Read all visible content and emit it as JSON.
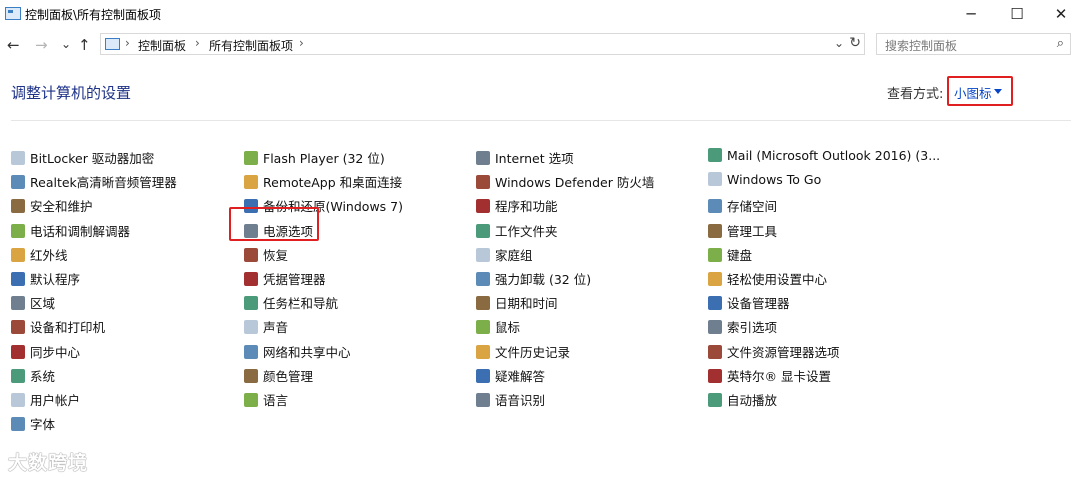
{
  "window": {
    "title": "控制面板\\所有控制面板项",
    "minimize": "─",
    "maximize": "☐",
    "close": "✕"
  },
  "nav": {
    "back": "←",
    "forward": "→",
    "recent": "⌄",
    "up": "↑"
  },
  "address": {
    "crumbs": [
      "控制面板",
      "所有控制面板项"
    ],
    "sep": "›",
    "dropdown": "⌄",
    "refresh": "↻"
  },
  "search": {
    "placeholder": "搜索控制面板",
    "icon": "⌕"
  },
  "heading": "调整计算机的设置",
  "view": {
    "label": "查看方式:",
    "value": "小图标"
  },
  "columns": [
    [
      {
        "label": "BitLocker 驱动器加密",
        "icon": "bitlocker-icon"
      },
      {
        "label": "Realtek高清晰音频管理器",
        "icon": "realtek-audio-icon"
      },
      {
        "label": "安全和维护",
        "icon": "flag-icon"
      },
      {
        "label": "电话和调制解调器",
        "icon": "phone-modem-icon"
      },
      {
        "label": "红外线",
        "icon": "infrared-icon"
      },
      {
        "label": "默认程序",
        "icon": "default-programs-icon"
      },
      {
        "label": "区域",
        "icon": "region-icon"
      },
      {
        "label": "设备和打印机",
        "icon": "printer-icon"
      },
      {
        "label": "同步中心",
        "icon": "sync-icon"
      },
      {
        "label": "系统",
        "icon": "system-icon"
      },
      {
        "label": "用户帐户",
        "icon": "users-icon"
      },
      {
        "label": "字体",
        "icon": "fonts-icon"
      }
    ],
    [
      {
        "label": "Flash Player (32 位)",
        "icon": "flash-icon"
      },
      {
        "label": "RemoteApp 和桌面连接",
        "icon": "remoteapp-icon"
      },
      {
        "label": "备份和还原(Windows 7)",
        "icon": "backup-icon"
      },
      {
        "label": "电源选项",
        "icon": "power-icon"
      },
      {
        "label": "恢复",
        "icon": "recovery-icon"
      },
      {
        "label": "凭据管理器",
        "icon": "credential-icon"
      },
      {
        "label": "任务栏和导航",
        "icon": "taskbar-icon"
      },
      {
        "label": "声音",
        "icon": "sound-icon"
      },
      {
        "label": "网络和共享中心",
        "icon": "network-icon"
      },
      {
        "label": "颜色管理",
        "icon": "color-icon"
      },
      {
        "label": "语言",
        "icon": "language-icon"
      }
    ],
    [
      {
        "label": "Internet 选项",
        "icon": "internet-icon"
      },
      {
        "label": "Windows Defender 防火墙",
        "icon": "firewall-icon"
      },
      {
        "label": "程序和功能",
        "icon": "programs-icon"
      },
      {
        "label": "工作文件夹",
        "icon": "work-folders-icon"
      },
      {
        "label": "家庭组",
        "icon": "homegroup-icon"
      },
      {
        "label": "强力卸载 (32 位)",
        "icon": "uninstall-icon"
      },
      {
        "label": "日期和时间",
        "icon": "datetime-icon"
      },
      {
        "label": "鼠标",
        "icon": "mouse-icon"
      },
      {
        "label": "文件历史记录",
        "icon": "file-history-icon"
      },
      {
        "label": "疑难解答",
        "icon": "troubleshoot-icon"
      },
      {
        "label": "语音识别",
        "icon": "speech-icon"
      }
    ],
    [
      {
        "label": "Mail (Microsoft Outlook 2016) (3...",
        "icon": "mail-icon"
      },
      {
        "label": "Windows To Go",
        "icon": "windows-to-go-icon"
      },
      {
        "label": "存储空间",
        "icon": "storage-icon"
      },
      {
        "label": "管理工具",
        "icon": "admin-tools-icon"
      },
      {
        "label": "键盘",
        "icon": "keyboard-icon"
      },
      {
        "label": "轻松使用设置中心",
        "icon": "ease-access-icon"
      },
      {
        "label": "设备管理器",
        "icon": "device-manager-icon"
      },
      {
        "label": "索引选项",
        "icon": "indexing-icon"
      },
      {
        "label": "文件资源管理器选项",
        "icon": "explorer-options-icon"
      },
      {
        "label": "英特尔® 显卡设置",
        "icon": "intel-graphics-icon"
      },
      {
        "label": "自动播放",
        "icon": "autoplay-icon"
      }
    ]
  ],
  "watermark": "大数跨境",
  "colors": {
    "link": "#0645c8",
    "heading": "#1e3287",
    "highlight": "#e02020"
  }
}
